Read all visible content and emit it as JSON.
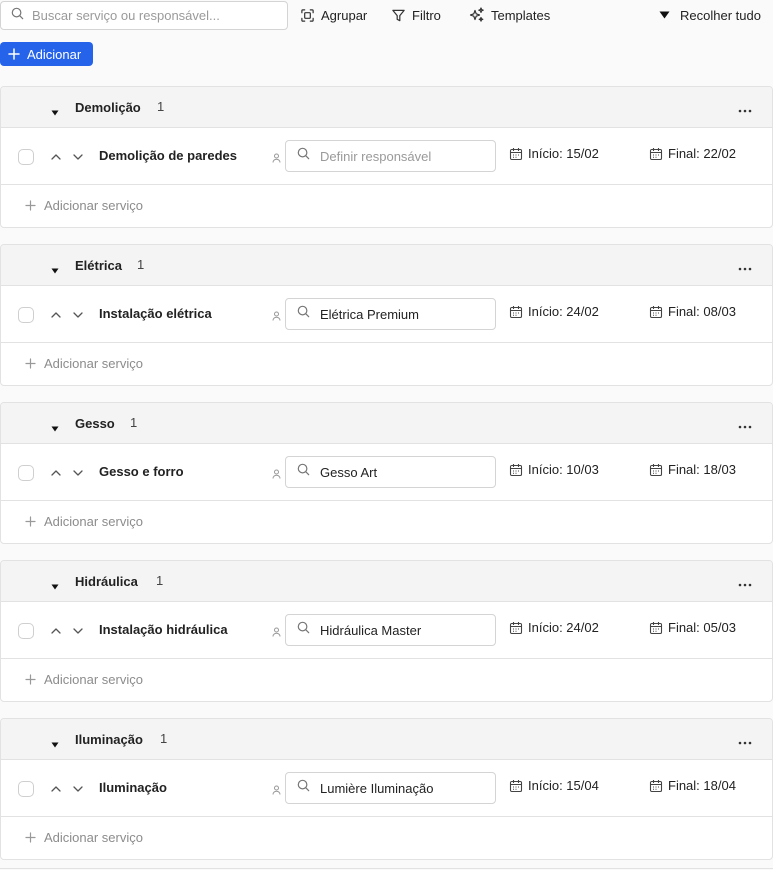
{
  "toolbar": {
    "search_placeholder": "Buscar serviço ou responsável...",
    "group_label": "Agrupar",
    "filter_label": "Filtro",
    "templates_label": "Templates",
    "collapse_label": "Recolher tudo",
    "add_label": "Adicionar"
  },
  "colors": {
    "accent": "#2563eb",
    "header_bg": "#f4f4f4",
    "border": "#e2e2e2",
    "placeholder": "#9a9a9a"
  },
  "icons": {
    "search": "search-icon",
    "group": "group-scan-icon",
    "filter": "funnel-icon",
    "templates": "sparkles-icon",
    "collapse": "caret-down-icon",
    "add": "plus-icon",
    "more": "ellipsis-icon",
    "move_up": "chevron-up-icon",
    "move_down": "chevron-down-icon",
    "person": "person-icon",
    "calendar": "calendar-icon"
  },
  "add_service_label": "Adicionar serviço",
  "groups": [
    {
      "title": "Demolição",
      "count": "1",
      "service": {
        "name": "Demolição de paredes",
        "responsible": "",
        "responsible_placeholder": "Definir responsável",
        "start": "Início: 15/02",
        "end": "Final: 22/02"
      }
    },
    {
      "title": "Elétrica",
      "count": "1",
      "service": {
        "name": "Instalação elétrica",
        "responsible": "Elétrica Premium",
        "responsible_placeholder": "Definir responsável",
        "start": "Início: 24/02",
        "end": "Final: 08/03"
      }
    },
    {
      "title": "Gesso",
      "count": "1",
      "service": {
        "name": "Gesso e forro",
        "responsible": "Gesso Art",
        "responsible_placeholder": "Definir responsável",
        "start": "Início: 10/03",
        "end": "Final: 18/03"
      }
    },
    {
      "title": "Hidráulica",
      "count": "1",
      "service": {
        "name": "Instalação hidráulica",
        "responsible": "Hidráulica Master",
        "responsible_placeholder": "Definir responsável",
        "start": "Início: 24/02",
        "end": "Final: 05/03"
      }
    },
    {
      "title": "Iluminação",
      "count": "1",
      "service": {
        "name": "Iluminação",
        "responsible": "Lumière Iluminação",
        "responsible_placeholder": "Definir responsável",
        "start": "Início: 15/04",
        "end": "Final: 18/04"
      }
    }
  ]
}
